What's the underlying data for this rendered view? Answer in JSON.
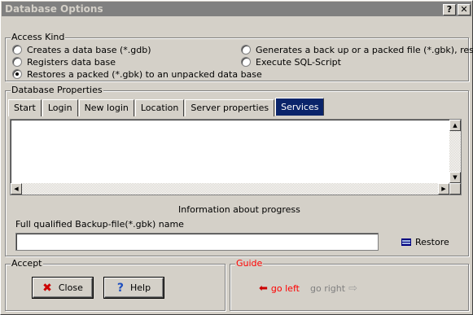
{
  "window": {
    "title": "Database Options"
  },
  "titlebar": {
    "help_label": "?",
    "close_label": "✕"
  },
  "access_kind": {
    "label": "Access Kind",
    "options": [
      {
        "label": "Creates a data base (*.gdb)",
        "checked": false
      },
      {
        "label": "Registers data base",
        "checked": false
      },
      {
        "label": "Restores a packed (*.gbk) to an unpacked data base",
        "checked": true
      },
      {
        "label": "Generates a back up or a packed file (*.gbk), resp.",
        "checked": false
      },
      {
        "label": "Execute SQL-Script",
        "checked": false
      }
    ]
  },
  "db_props": {
    "label": "Database Properties",
    "tabs": [
      "Start",
      "Login",
      "New login",
      "Location",
      "Server properties",
      "Services"
    ],
    "active_tab": "Services",
    "progress_label": "Information about progress",
    "file_label": "Full qualified Backup-file(*.gbk) name",
    "file_value": "",
    "restore_label": "Restore"
  },
  "accept": {
    "label": "Accept",
    "close_label": "Close",
    "help_label": "Help"
  },
  "guide": {
    "label": "Guide",
    "left_label": "go left",
    "right_label": "go right"
  },
  "colors": {
    "accent": "#0a246a",
    "guide_red": "#ff0000",
    "disabled": "#808080"
  },
  "icons": {
    "close": "x-icon",
    "help": "question-icon",
    "restore": "restore-icon",
    "left": "arrow-left-icon",
    "right": "arrow-right-icon"
  }
}
